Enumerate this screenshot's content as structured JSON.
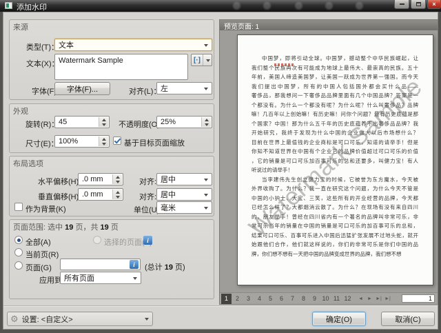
{
  "window": {
    "title": "添加水印",
    "close_glyph": "×"
  },
  "source": {
    "title": "来源",
    "type_label": "类型(T)：",
    "type_value": "文本",
    "text_label": "文本(X)：",
    "text_value": "Watermark Sample",
    "macro_icon": "[·]",
    "font_label": "字体(F):",
    "font_button": "字体(F)...",
    "align_label": "对齐(L)：",
    "align_value": "左"
  },
  "appearance": {
    "title": "外观",
    "rotation_label": "旋转(R)：",
    "rotation_value": "45",
    "opacity_label": "不透明度(O):",
    "opacity_value": "25%",
    "size_label": "尺寸(E)：",
    "size_value": "100%",
    "scale_checkbox": "基于目标页面缩放"
  },
  "layout": {
    "title": "布局选项",
    "h_offset_label": "水平偏移(H):",
    "h_offset_value": ".0 mm",
    "v_offset_label": "垂直偏移(H):",
    "v_offset_value": ".0 mm",
    "align_label": "对齐:",
    "h_align_value": "居中",
    "v_align_value": "居中",
    "background_checkbox": "作为背景(K)",
    "unit_label": "单位(U):",
    "unit_value": "毫米"
  },
  "page_range": {
    "header_prefix": "页面范围: 选中 ",
    "selected_count": "19",
    "header_mid": " 页，共 ",
    "total_count": "19",
    "header_suffix": " 页",
    "all_radio": "全部(A)",
    "selected_pages_radio": "选择的页面(S)",
    "current_radio": "当前页(R)",
    "pages_radio": "页面(G)",
    "pages_value": "",
    "total_prefix": "(总计 ",
    "total_num": "19",
    "total_suffix": " 页)",
    "apply_label": "应用到:",
    "apply_value": "所有页面",
    "info_glyph": "i"
  },
  "footer": {
    "gear_icon": "⚙",
    "settings_text": "设置: <自定义>",
    "ok": "确定(O)",
    "cancel": "取消(C)"
  },
  "preview": {
    "header": "预览页面: 1",
    "watermark": "Watermark Sample",
    "pager": {
      "pages": [
        "1",
        "2",
        "3",
        "4",
        "5",
        "6",
        "7",
        "8",
        "9",
        "10",
        "11",
        "12"
      ],
      "nav": [
        "◄",
        "►",
        "►|",
        "►|"
      ],
      "current": "1"
    },
    "document": {
      "para1_lines": [
        "中国梦，即将引动全球。中国梦，撼动整个中华民族崛起，让",
        "我们整个民族再次有可能成为地球上最伟大、最崇高的民族。五十",
        "年前，美国人缔造美国梦，让美国一跃成为世界第一强国。而今天",
        "我们提出中国梦，所有的中国人包括国外都会买什么品——",
        "奢侈品，那我想问一下奢侈品品牌里面有几个中国品牌？答案是一",
        "个都没有。为什么一个都没有呢？为什么呢？什么叫奢侈品？品牌",
        "嘛！几百年以上创始嘛！有历史嘛！问你个问题？最有历史底蕴是那",
        "个国家？中国！那为什么五千年的历史底蕴养不出奢侈品品牌？我",
        "开始研究，我终于发现为什么中国的企业做大以后市场想什么？",
        "目前在世界上最值钱的企业商标是可口可乐，知道的请举手！但是",
        "你知不知道世界在中国有个企业它的品牌价值超过可口可乐的价值",
        "，它的销量是可口可乐加百事可乐的总和还要多，叫健力宝！有人",
        "听说过的请举手！"
      ],
      "para2_lines": [
        "当李建伟先生创立健力宝的时候，它被誉为东方魔水，今天被",
        "外界收购了。为什么？我一直在研究这个问题，为什么今天不管是",
        "中国的小护士、大宝、三笑，这些所有的开业经营的品牌，今天都",
        "已经怎么样了？大都烟消云散了。为什么？在现场有没有来自四川",
        "的，朋友举手！曾经在四川省内有一个著名的品牌叫非常可乐，非",
        "常可乐当年的销量在中国的销量是可口可乐的加百事可乐的总和，",
        "结果可口可乐、百事可乐进入中国后迅猛扩张发展不过地头蛇，就开",
        "始跟他们合作，他们就这样说的，你们的非常可乐是你们中国的品",
        "牌，你们想不想有一天把中国的品牌变成世界的品牌，我们想不想"
      ]
    }
  },
  "colors": {
    "focus_border": "#c3a45f",
    "info_blue": "#2f6db3",
    "close_red": "#c0392b",
    "check_blue": "#3a6ea5",
    "watermark_gray": "#696969",
    "annotation_red": "#c24a3a"
  }
}
